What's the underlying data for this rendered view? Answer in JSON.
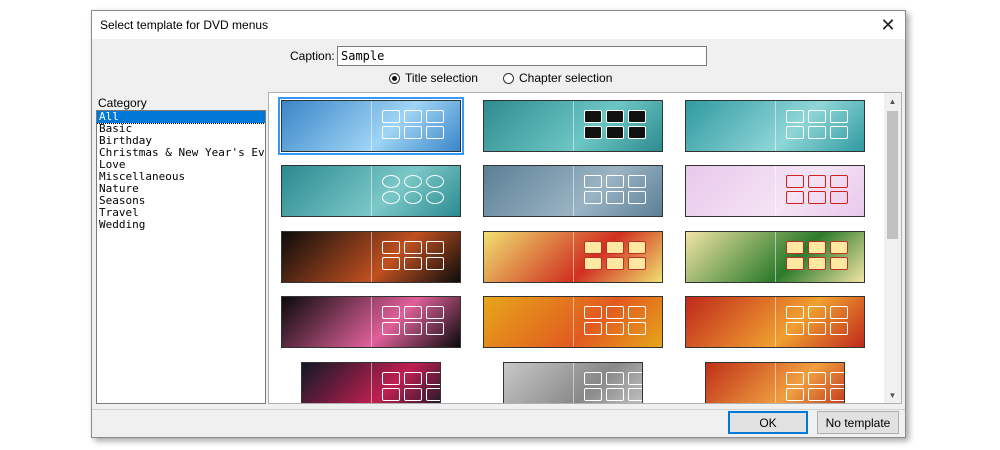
{
  "dialog": {
    "title": "Select template for DVD menus",
    "close_icon": "close-icon"
  },
  "caption": {
    "label": "Caption:",
    "value": "Sample"
  },
  "mode": {
    "options": [
      {
        "label": "Title selection",
        "checked": true
      },
      {
        "label": "Chapter selection",
        "checked": false
      }
    ]
  },
  "category": {
    "label": "Category",
    "items": [
      "All",
      "Basic",
      "Birthday",
      "Christmas & New Year's Ev",
      "Love",
      "Miscellaneous",
      "Nature",
      "Seasons",
      "Travel",
      "Wedding"
    ],
    "selected": "All"
  },
  "templates": {
    "selected_index": 0,
    "thumbnails": [
      {
        "name": "blue-wave",
        "bg": "#3a86c8",
        "accent": "#9fd4f5"
      },
      {
        "name": "teal-dark-buttons",
        "bg": "#2e8c8f",
        "accent": "#6cc6c4"
      },
      {
        "name": "teal-panels",
        "bg": "#2f9aa0",
        "accent": "#8fd6d8"
      },
      {
        "name": "teal-ovals",
        "bg": "#2a8a90",
        "accent": "#7cc8c8"
      },
      {
        "name": "slate-blue",
        "bg": "#5c7f95",
        "accent": "#9ab4c4"
      },
      {
        "name": "birthday-pink",
        "bg": "#e9c8ec",
        "accent": "#f4e4f4"
      },
      {
        "name": "birthday-cake",
        "bg": "#0c0c0c",
        "accent": "#c05020"
      },
      {
        "name": "christmas-tree",
        "bg": "#f0e070",
        "accent": "#d03020"
      },
      {
        "name": "christmas-cream",
        "bg": "#f2e4a4",
        "accent": "#2a7a2a"
      },
      {
        "name": "fireworks-night",
        "bg": "#0a0a0a",
        "accent": "#e0609a"
      },
      {
        "name": "golden-heart",
        "bg": "#e6a61a",
        "accent": "#e25a20"
      },
      {
        "name": "red-hearts",
        "bg": "#c0281c",
        "accent": "#f0a030"
      },
      {
        "name": "dark-swirl",
        "bg": "#101826",
        "accent": "#c02050"
      },
      {
        "name": "grey-album",
        "bg": "#c8c8c8",
        "accent": "#888888"
      },
      {
        "name": "sunset-red",
        "bg": "#c0301a",
        "accent": "#f0a040"
      }
    ]
  },
  "buttons": {
    "ok": "OK",
    "no_template": "No template"
  }
}
